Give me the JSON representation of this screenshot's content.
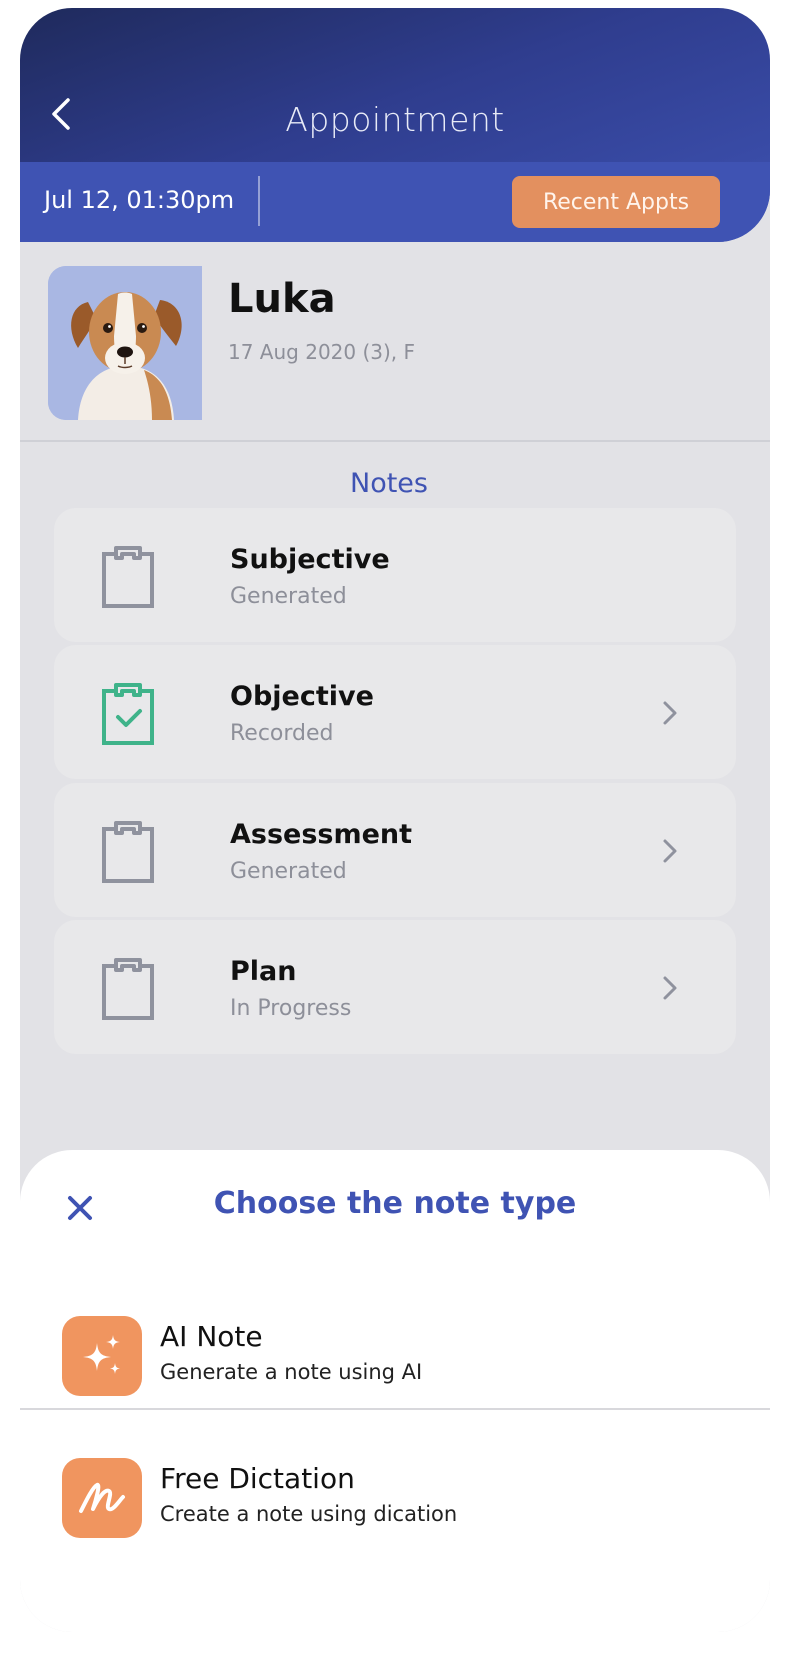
{
  "header": {
    "title": "Appointment",
    "date": "Jul 12, 01:30pm",
    "recent_button": "Recent Appts"
  },
  "pet": {
    "name": "Luka",
    "meta": "17 Aug 2020 (3), F"
  },
  "tabs": {
    "active": "Notes"
  },
  "notes": [
    {
      "title": "Subjective",
      "status": "Generated"
    },
    {
      "title": "Objective",
      "status": "Recorded"
    },
    {
      "title": "Assessment",
      "status": "Generated"
    },
    {
      "title": "Plan",
      "status": "In Progress"
    }
  ],
  "sheet": {
    "title": "Choose the note type",
    "options": [
      {
        "title": "AI Note",
        "description": "Generate a note using AI",
        "icon": "sparkle-icon"
      },
      {
        "title": "Free Dictation",
        "description": "Create a note using dication",
        "icon": "handwriting-icon"
      }
    ]
  },
  "colors": {
    "primary": "#3f53b3",
    "accent": "#e3905f",
    "success": "#3fb38a",
    "muted": "#8d8f99"
  }
}
